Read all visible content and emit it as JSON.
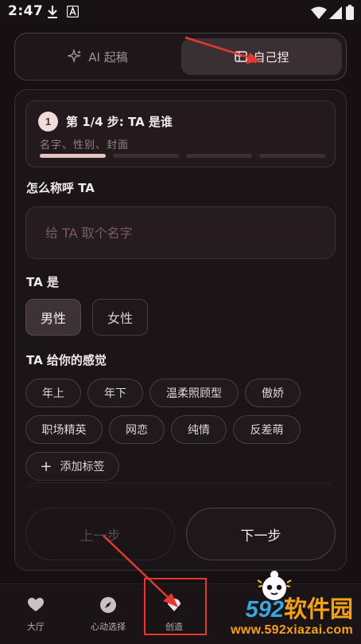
{
  "status_bar": {
    "time": "2:47",
    "icons": [
      "download-icon",
      "font-icon",
      "wifi-icon",
      "signal-icon",
      "battery-icon"
    ]
  },
  "mode_toggle": {
    "ai_label": "AI 起稿",
    "self_label": "自己捏",
    "selected": "self"
  },
  "step": {
    "number": "1",
    "title": "第 1/4 步: TA 是谁",
    "subtitle": "名字、性别、封面",
    "current": 1,
    "total": 4
  },
  "name_field": {
    "label": "怎么称呼 TA",
    "placeholder": "给 TA 取个名字",
    "value": ""
  },
  "gender": {
    "label": "TA 是",
    "options": [
      "男性",
      "女性"
    ],
    "selected": "男性"
  },
  "feelings": {
    "label": "TA 给你的感觉",
    "tags": [
      "年上",
      "年下",
      "温柔照顾型",
      "傲娇",
      "职场精英",
      "网恋",
      "纯情",
      "反差萌"
    ],
    "add_label": "添加标签"
  },
  "actions": {
    "prev_label": "上一步",
    "next_label": "下一步"
  },
  "bottom_nav": {
    "tabs": [
      {
        "label": "大厅",
        "icon": "heart-icon"
      },
      {
        "label": "心动选择",
        "icon": "compass-icon"
      },
      {
        "label": "创造",
        "icon": "create-icon"
      }
    ]
  },
  "watermark": {
    "number": "592",
    "text": "软件园",
    "url": "www.592xiazai.com"
  },
  "colors": {
    "background": "#161012",
    "panel": "#1c1517",
    "accent": "#e8c4c0",
    "annotation_red": "#e23a33",
    "watermark_blue": "#37a7e0",
    "watermark_orange": "#f6a11a"
  }
}
